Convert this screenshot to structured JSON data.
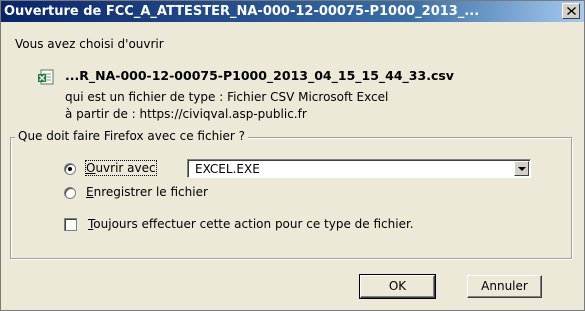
{
  "window": {
    "title": "Ouverture de FCC_A_ATTESTER_NA-000-12-00075-P1000_2013_...",
    "close_glyph": "✕"
  },
  "intro_text": "Vous avez choisi d'ouvrir",
  "file": {
    "name": "...R_NA-000-12-00075-P1000_2013_04_15_15_44_33.csv",
    "type_line": "qui est un fichier de type :  Fichier CSV Microsoft Excel",
    "source_line": "à partir de : https://civiqval.asp-public.fr",
    "icon": "excel-csv-icon"
  },
  "group": {
    "legend": "Que doit faire Firefox avec ce fichier ?",
    "open_with": {
      "mnemonic": "O",
      "rest": "uvrir avec",
      "checked": true
    },
    "open_with_app": "EXCEL.EXE",
    "save": {
      "mnemonic": "E",
      "rest": "nregistrer le fichier",
      "checked": false
    },
    "always": {
      "mnemonic": "T",
      "rest": "oujours effectuer cette action pour ce type de fichier.",
      "checked": false
    }
  },
  "buttons": {
    "ok": "OK",
    "cancel": "Annuler"
  }
}
